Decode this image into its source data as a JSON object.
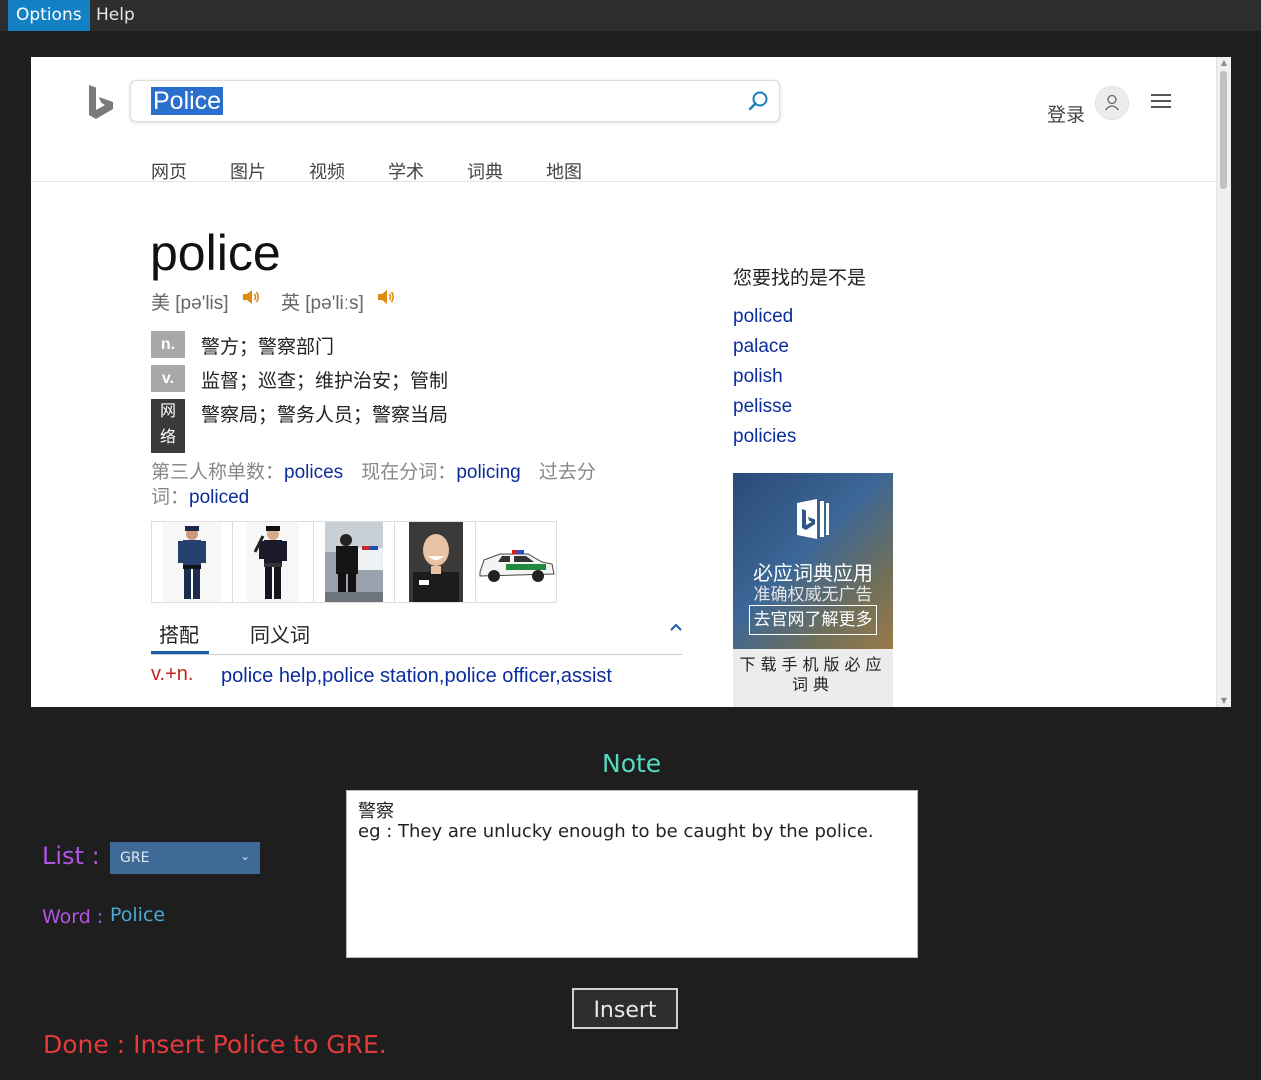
{
  "menu": {
    "options": "Options",
    "help": "Help"
  },
  "bing": {
    "search_value": "Police",
    "login": "登录",
    "nav_tabs": [
      "网页",
      "图片",
      "视频",
      "学术",
      "词典",
      "地图"
    ]
  },
  "entry": {
    "headword": "police",
    "pron_us": "美 [pə'lis]",
    "pron_uk": "英 [pə'liːs]",
    "definitions": [
      {
        "pos": "n.",
        "text": "警方；警察部门"
      },
      {
        "pos": "v.",
        "text": "监督；巡查；维护治安；管制"
      },
      {
        "pos": "网络",
        "text": "警察局；警务人员；警察当局"
      }
    ],
    "forms": {
      "third_label": "第三人称单数：",
      "third": "polices",
      "present_label": "现在分词：",
      "present": "policing",
      "past_label": "过去分词：",
      "past": "policed"
    },
    "tabs": {
      "collocation": "搭配",
      "synonym": "同义词"
    },
    "collocation": {
      "pos": "v.+n.",
      "text": "police help,police station,police officer,assist"
    }
  },
  "sidebar": {
    "did_you_mean": "您要找的是不是",
    "suggestions": [
      "policed",
      "palace",
      "polish",
      "pelisse",
      "policies"
    ],
    "ad": {
      "title": "必应词典应用",
      "subtitle": "准确权威无广告",
      "button": "去官网了解更多",
      "footer": "下载手机版必应词典"
    }
  },
  "panel": {
    "note_title": "Note",
    "list_label": "List :",
    "list_value": "GRE",
    "word_label": "Word :",
    "word_value": "Police",
    "note_lines": [
      "警察",
      "eg : They are unlucky enough to be caught by the police."
    ],
    "insert_button": "Insert",
    "status": "Done : Insert Police to GRE."
  },
  "colors": {
    "accent_menu": "#1380c4",
    "note_title": "#57d9c0",
    "label_purple": "#b155e6",
    "word_value": "#4aa6d6",
    "status_red": "#e33a3a",
    "link_blue": "#0b2d9c"
  }
}
